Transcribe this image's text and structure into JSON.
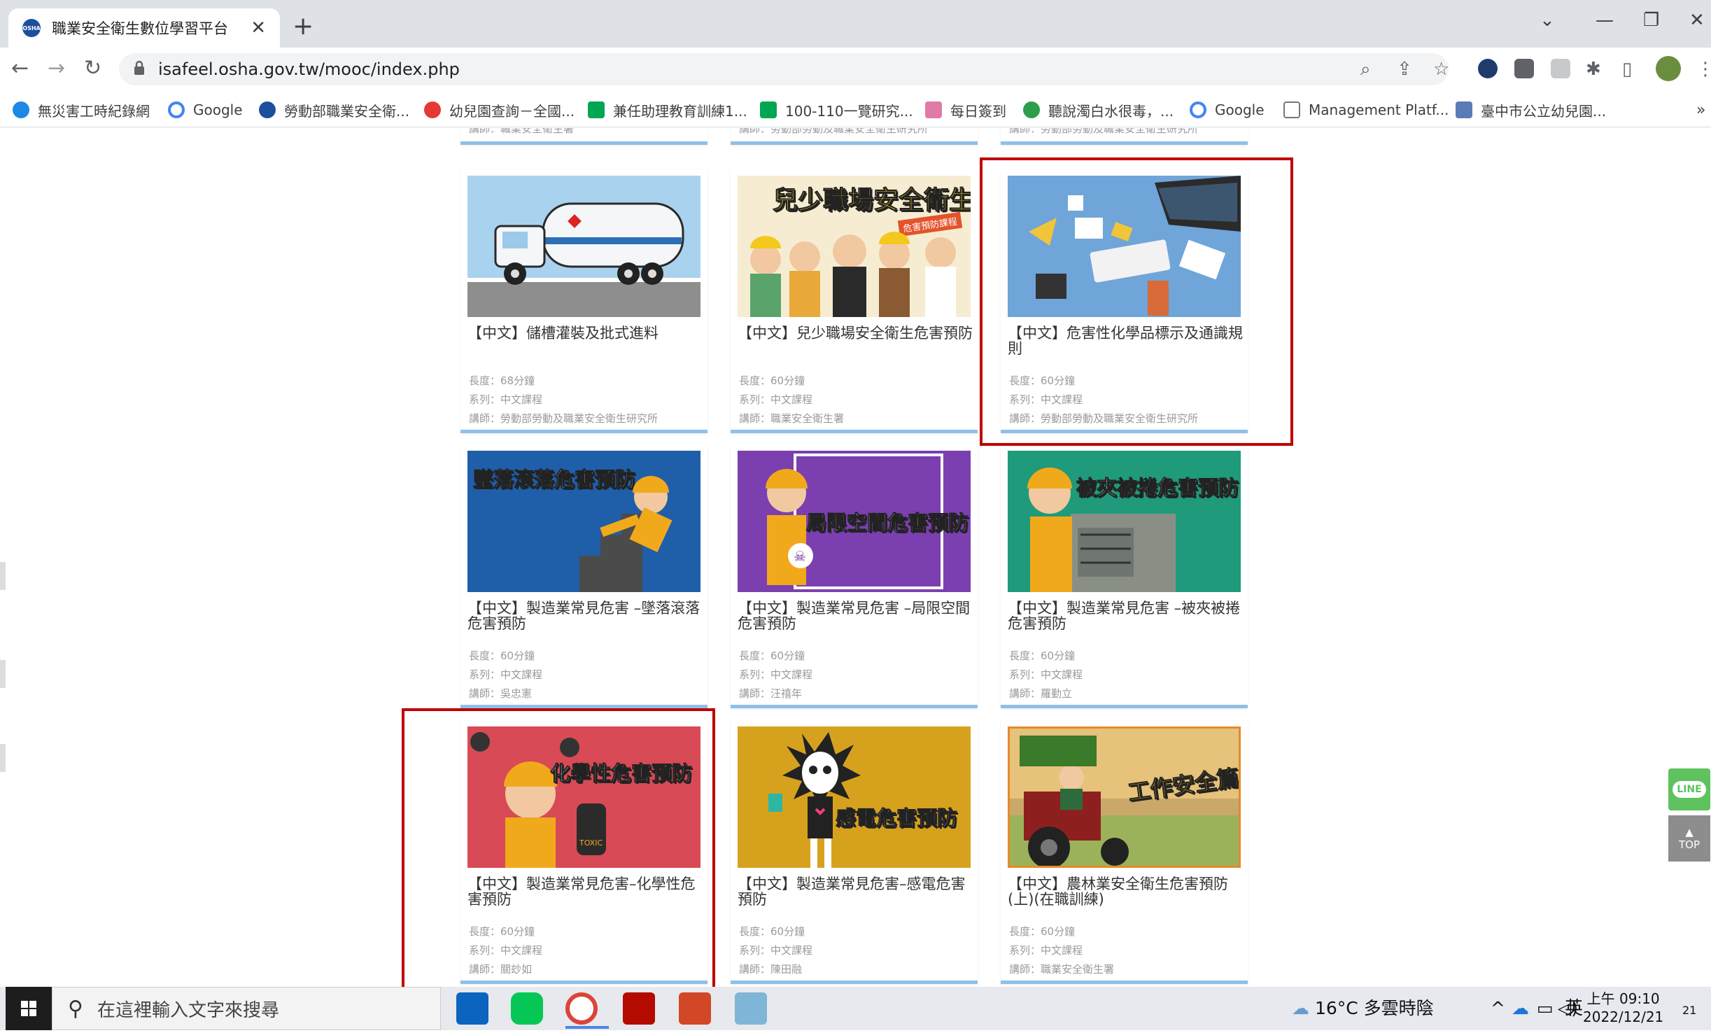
{
  "browser": {
    "tab_title": "職業安全衛生數位學習平台",
    "favicon_text": "OSHA",
    "url": "isafeel.osha.gov.tw/mooc/index.php"
  },
  "bookmarks": [
    {
      "label": "無災害工時紀錄網",
      "color": "#1e88e5"
    },
    {
      "label": "Google",
      "color": "#4285f4"
    },
    {
      "label": "勞動部職業安全衛...",
      "color": "#1c4f9c"
    },
    {
      "label": "幼兒園查詢－全國...",
      "color": "#e53935"
    },
    {
      "label": "兼任助理教育訓練1...",
      "color": "#00a651"
    },
    {
      "label": "100-110一覽研究...",
      "color": "#00a651"
    },
    {
      "label": "每日簽到",
      "color": "#e07aa8"
    },
    {
      "label": "聽說濁白水很毒，...",
      "color": "#2e9d4b"
    },
    {
      "label": "Google",
      "color": "#4285f4"
    },
    {
      "label": "Management Platf...",
      "color": "#777777"
    },
    {
      "label": "臺中市公立幼兒園...",
      "color": "#5a7bb5"
    }
  ],
  "top_row_instructors": [
    "講師：職業安全衛生署",
    "講師：勞動部勞動及職業安全衛生研究所",
    "講師：勞動部勞動及職業安全衛生研究所"
  ],
  "courses": [
    {
      "title": "【中文】儲槽灌裝及批式進料",
      "length": "長度：68分鐘",
      "series": "系列：中文課程",
      "instructor": "講師：勞動部勞動及職業安全衛生研究所",
      "thumb_label": "",
      "thumb_bg": "#9dc9ea"
    },
    {
      "title": "【中文】兒少職場安全衛生危害預防",
      "length": "長度：60分鐘",
      "series": "系列：中文課程",
      "instructor": "講師：職業安全衛生署",
      "thumb_label": "兒少職場安全衛生",
      "thumb_sub": "危害預防課程",
      "thumb_bg": "#f3e7c9"
    },
    {
      "title": "【中文】危害性化學品標示及通識規則",
      "length": "長度：60分鐘",
      "series": "系列：中文課程",
      "instructor": "講師：勞動部勞動及職業安全衛生研究所",
      "thumb_label": "",
      "thumb_bg": "#6fa3d8"
    },
    {
      "title": "【中文】製造業常見危害 –墜落滾落危害預防",
      "length": "長度：60分鐘",
      "series": "系列：中文課程",
      "instructor": "講師：吳忠憲",
      "thumb_label": "墜落滾落危害預防",
      "thumb_bg": "#1f5ea8"
    },
    {
      "title": "【中文】製造業常見危害 –局限空間危害預防",
      "length": "長度：60分鐘",
      "series": "系列：中文課程",
      "instructor": "講師：汪禧年",
      "thumb_label": "局限空間危害預防",
      "thumb_bg": "#7b3fb0"
    },
    {
      "title": "【中文】製造業常見危害 –被夾被捲危害預防",
      "length": "長度：60分鐘",
      "series": "系列：中文課程",
      "instructor": "講師：羅勤立",
      "thumb_label": "被夾被捲危害預防",
      "thumb_bg": "#1f9a7a"
    },
    {
      "title": "【中文】製造業常見危害–化學性危害預防",
      "length": "長度：60分鐘",
      "series": "系列：中文課程",
      "instructor": "講師：關玅如",
      "thumb_label": "化學性危害預防",
      "thumb_bg": "#d84a55"
    },
    {
      "title": "【中文】製造業常見危害–感電危害預防",
      "length": "長度：60分鐘",
      "series": "系列：中文課程",
      "instructor": "講師：陳田融",
      "thumb_label": "感電危害預防",
      "thumb_bg": "#d6a21e"
    },
    {
      "title": "【中文】農林業安全衛生危害預防(上)(在職訓練)",
      "length": "長度：60分鐘",
      "series": "系列：中文課程",
      "instructor": "講師：職業安全衛生署",
      "thumb_label": "工作安全篇",
      "thumb_bg": "#e0b96a"
    }
  ],
  "floating": {
    "line_label": "LINE",
    "top_label": "TOP"
  },
  "taskbar": {
    "search_placeholder": "在這裡輸入文字來搜尋",
    "weather": "16°C 多雲時陰",
    "ime": "英",
    "time": "上午 09:10",
    "date": "2022/12/21",
    "notification_count": "21"
  }
}
